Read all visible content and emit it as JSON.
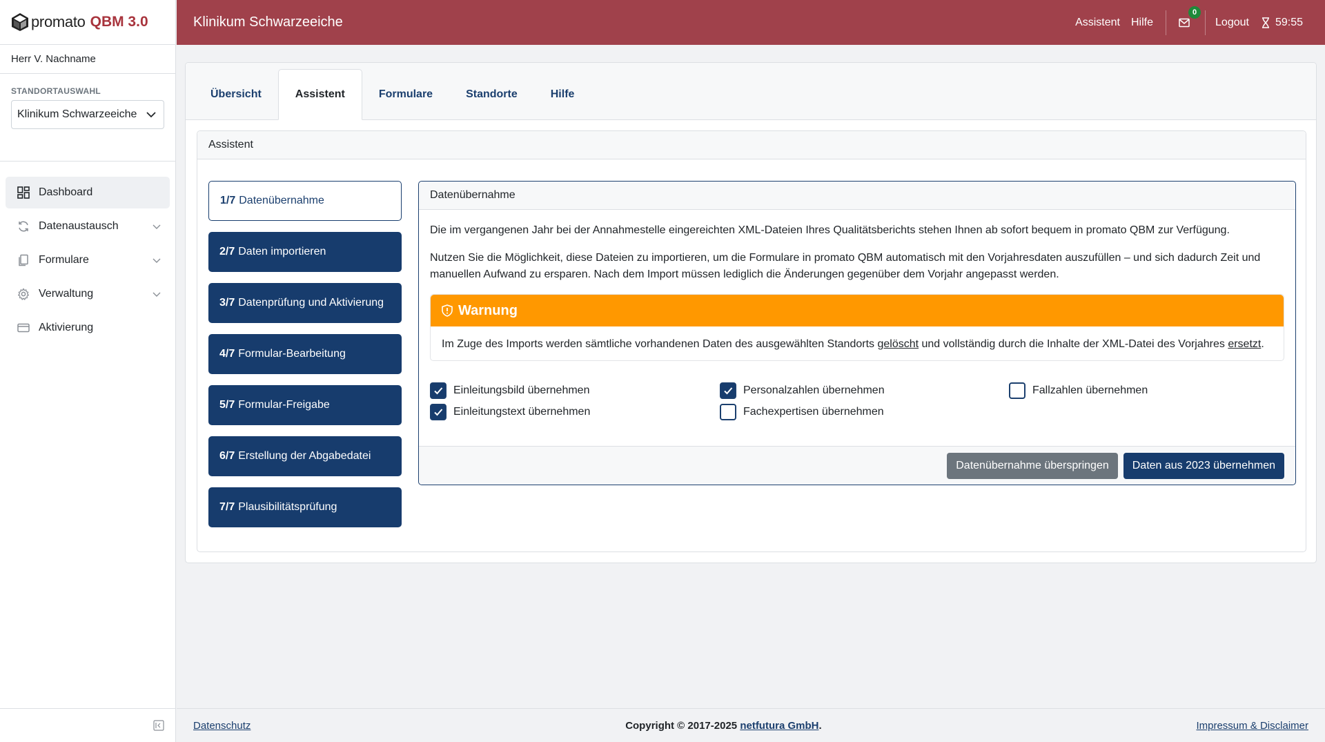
{
  "brand": {
    "word": "promato",
    "product": "QBM 3.0",
    "accent": "#a8343d"
  },
  "user": {
    "name": "Herr V. Nachname"
  },
  "standort": {
    "label": "STANDORTAUSWAHL",
    "selected": "Klinikum Schwarzeeiche"
  },
  "nav": [
    {
      "label": "Dashboard",
      "icon": "grid-icon"
    },
    {
      "label": "Datenaustausch",
      "icon": "sync-icon"
    },
    {
      "label": "Formulare",
      "icon": "copy-icon"
    },
    {
      "label": "Verwaltung",
      "icon": "gear-icon"
    },
    {
      "label": "Aktivierung",
      "icon": "card-icon"
    }
  ],
  "header": {
    "title": "Klinikum Schwarzeeiche",
    "links": [
      "Assistent",
      "Hilfe"
    ],
    "mail_count": "0",
    "logout": "Logout",
    "timer": "59:55",
    "color": "#a0414b"
  },
  "tabs": [
    "Übersicht",
    "Assistent",
    "Formulare",
    "Standorte",
    "Hilfe"
  ],
  "assistant": {
    "title": "Assistent",
    "steps": [
      {
        "num": "1/7",
        "label": "Datenübernahme"
      },
      {
        "num": "2/7",
        "label": "Daten importieren"
      },
      {
        "num": "3/7",
        "label": "Datenprüfung und Aktivierung"
      },
      {
        "num": "4/7",
        "label": "Formular-Bearbeitung"
      },
      {
        "num": "5/7",
        "label": "Formular-Freigabe"
      },
      {
        "num": "6/7",
        "label": "Erstellung der Abgabedatei"
      },
      {
        "num": "7/7",
        "label": "Plausibilitätsprüfung"
      }
    ]
  },
  "detail": {
    "title": "Datenübernahme",
    "para1": "Die im vergangenen Jahr bei der Annahmestelle eingereichten XML-Dateien Ihres Qualitätsberichts stehen Ihnen ab sofort bequem in promato QBM zur Verfügung.",
    "para2": "Nutzen Sie die Möglichkeit, diese Dateien zu importieren, um die Formulare in promato QBM automatisch mit den Vorjahresdaten auszufüllen – und sich dadurch Zeit und manuellen Aufwand zu ersparen. Nach dem Import müssen lediglich die Änderungen gegenüber dem Vorjahr angepasst werden.",
    "warning": {
      "title": "Warnung",
      "text_before": "Im Zuge des Imports werden sämtliche vorhandenen Daten des ausgewählten Standorts ",
      "link1": "gelöscht",
      "text_middle": " und vollständig durch die Inhalte der XML-Datei des Vorjahres ",
      "link2": "ersetzt",
      "text_after": ".",
      "color": "#ff9800"
    },
    "checks": {
      "einleitungsbild": {
        "label": "Einleitungsbild übernehmen",
        "checked": true
      },
      "personalzahlen": {
        "label": "Personalzahlen übernehmen",
        "checked": true
      },
      "fallzahlen": {
        "label": "Fallzahlen übernehmen",
        "checked": false
      },
      "einleitungstext": {
        "label": "Einleitungstext übernehmen",
        "checked": true
      },
      "fachexpertisen": {
        "label": "Fachexpertisen übernehmen",
        "checked": false
      }
    },
    "skip_button": "Datenübernahme überspringen",
    "import_button": "Daten aus 2023 übernehmen"
  },
  "footer": {
    "privacy": "Datenschutz",
    "copyright_prefix": "Copyright © 2017-2025 ",
    "company": "netfutura GmbH",
    "copyright_suffix": ".",
    "imprint": "Impressum & Disclaimer"
  }
}
